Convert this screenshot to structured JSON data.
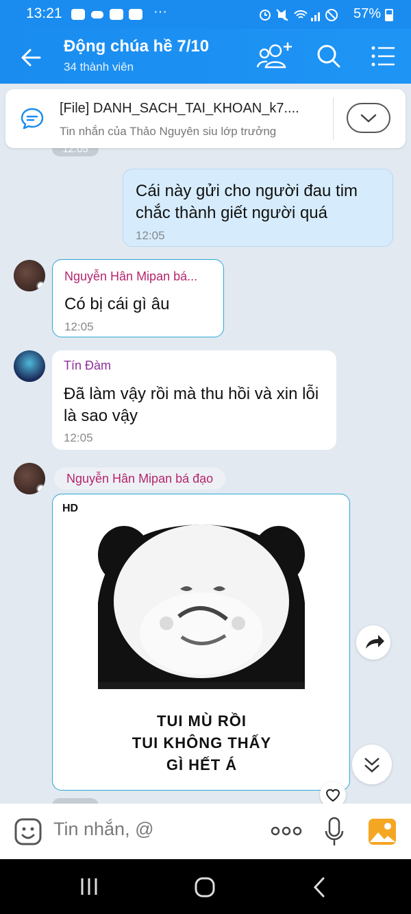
{
  "status_bar": {
    "time": "13:21",
    "battery": "57%"
  },
  "header": {
    "title": "Động chúa hề 7/10",
    "subtitle": "34 thành viên"
  },
  "pinned": {
    "title": "[File] DANH_SACH_TAI_KHOAN_k7....",
    "subtitle": "Tin nhắn của Thảo Nguyên siu lớp trưởng"
  },
  "partial_time_top": "12:05",
  "messages": [
    {
      "type": "sent",
      "text": "Cái này gửi cho người đau tim chắc thành giết người quá",
      "time": "12:05"
    },
    {
      "type": "received",
      "sender": "Nguyễn Hân Mipan bá...",
      "text": "Có bị cái gì âu",
      "time": "12:05"
    },
    {
      "type": "received",
      "sender": "Tín Đàm",
      "text": "Đã làm vậy rồi mà thu hồi và xin lỗi là sao vậy",
      "time": "12:05"
    },
    {
      "type": "sticker",
      "sender": "Nguyễn Hân Mipan bá đạo",
      "badge": "HD",
      "caption": [
        "TUI MÙ RỒI",
        "TUI KHÔNG THẤY",
        "GÌ HẾT Á"
      ]
    }
  ],
  "input": {
    "placeholder": "Tin nhắn, @"
  },
  "colors": {
    "header": "#1a8cf0",
    "sender_pink": "#b5246e",
    "sender_purple": "#8a2f9a",
    "sent_bubble": "#d6ecfc",
    "chat_bg": "#e2e9f1"
  }
}
